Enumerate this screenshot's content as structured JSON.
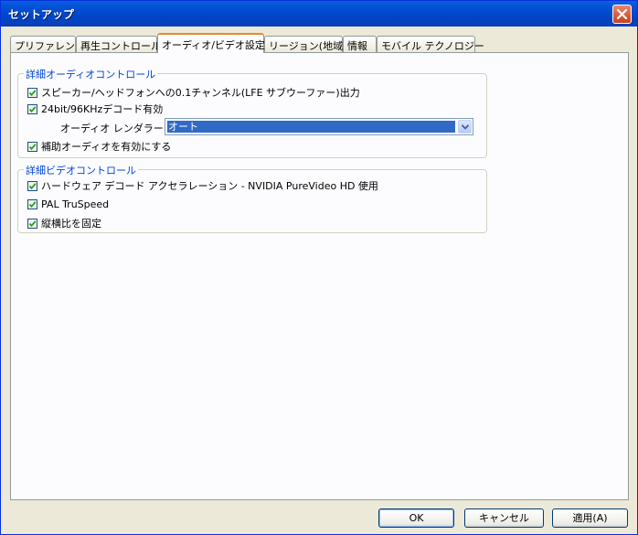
{
  "window": {
    "title": "セットアップ"
  },
  "tabs": [
    {
      "label": "プリファレンス"
    },
    {
      "label": "再生コントロール"
    },
    {
      "label": "オーディオ/ビデオ設定"
    },
    {
      "label": "リージョン(地域)"
    },
    {
      "label": "情報"
    },
    {
      "label": "モバイル テクノロジー"
    }
  ],
  "audio_group": {
    "title": "詳細オーディオコントロール",
    "speaker_output": {
      "label": "スピーカー/ヘッドフォンへの0.1チャンネル(LFE サブウーファー)出力",
      "checked": true
    },
    "hd_decode": {
      "label": "24bit/96KHzデコード有効",
      "checked": true
    },
    "renderer": {
      "label": "オーディオ レンダラー:",
      "value": "オート"
    },
    "aux_audio": {
      "label": "補助オーディオを有効にする",
      "checked": true
    }
  },
  "video_group": {
    "title": "詳細ビデオコントロール",
    "hw_decode": {
      "label": "ハードウェア デコード アクセラレーション - NVIDIA PureVideo HD 使用",
      "checked": true
    },
    "pal_truspeed": {
      "label": "PAL TruSpeed",
      "checked": true
    },
    "aspect_lock": {
      "label": "縦横比を固定",
      "checked": true
    }
  },
  "buttons": {
    "ok": "OK",
    "cancel": "キャンセル",
    "apply": "適用(A)"
  }
}
